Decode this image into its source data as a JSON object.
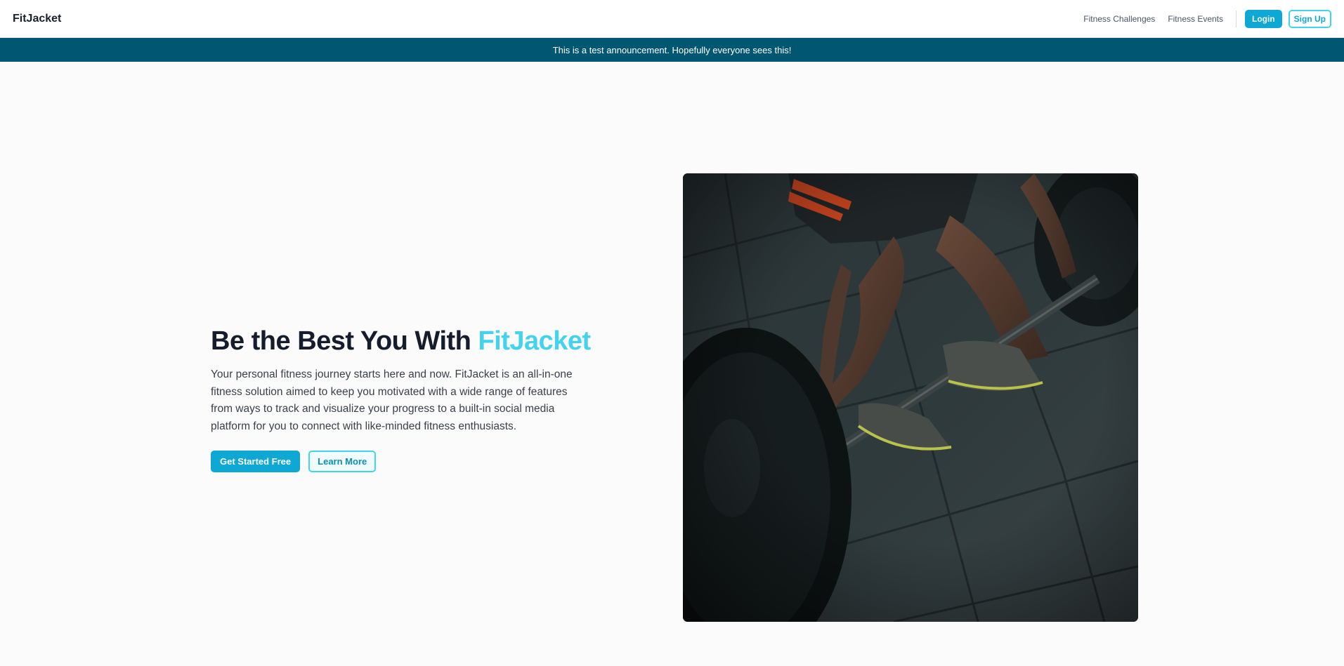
{
  "navbar": {
    "brand": "FitJacket",
    "links": [
      "Fitness Challenges",
      "Fitness Events"
    ],
    "login_label": "Login",
    "signup_label": "Sign Up"
  },
  "announcement": {
    "text": "This is a test announcement. Hopefully everyone sees this!"
  },
  "hero": {
    "title_prefix": "Be the Best You With ",
    "title_accent": "FitJacket",
    "body": "Your personal fitness journey starts here and now. FitJacket is an all-in-one fitness solution aimed to keep you motivated with a wide range of features from ways to track and visualize your progress to a built-in social media platform for you to connect with like-minded fitness enthusiasts.",
    "primary_cta": "Get Started Free",
    "secondary_cta": "Learn More",
    "image_icon": "barbell-deadlift-photo"
  },
  "colors": {
    "accent": "#0da8d4",
    "accent_light": "#43d3ee",
    "announcement_bg": "#015772"
  }
}
